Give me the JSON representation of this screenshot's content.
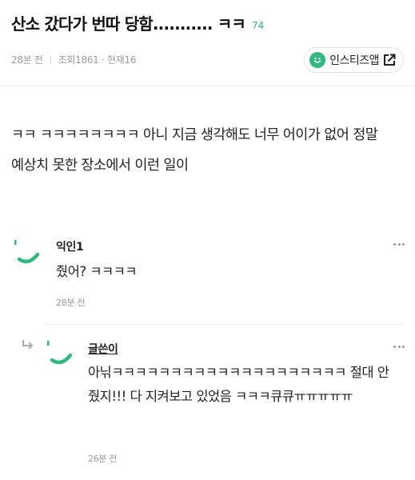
{
  "post": {
    "title": "산소 갔다가 번따 당함........... ㅋㅋ",
    "comment_count": "74",
    "time_ago": "28분 전",
    "views": "조회1861 · 현재16",
    "app_button_label": "인스티즈앱",
    "body": "ㅋㅋ ㅋㅋㅋㅋㅋㅋㅋㅋ 아니 지금 생각해도 너무 어이가 없어 정말 예상치 못한 장소에서 이런 일이"
  },
  "comments": [
    {
      "nickname": "익인1",
      "text": "줬어? ㅋㅋㅋㅋ",
      "time_ago": "28분 전"
    },
    {
      "nickname": "글쓴이",
      "text": "아닊ㅋㅋㅋㅋㅋㅋㅋㅋㅋㅋㅋㅋㅋㅋㅋㅋㅋㅋㅋㅋ 절대 안 줬지!!! 다 지켜보고 있었음 ㅋㅋㅋ큐큐ㅠㅠㅠㅠㅠ",
      "time_ago": "26분 전"
    }
  ],
  "colors": {
    "accent": "#2fb981",
    "meta_text": "#9a9a9a"
  },
  "icons": [
    "smile-icon",
    "external-link-icon",
    "more-icon",
    "reply-arrow-icon"
  ]
}
